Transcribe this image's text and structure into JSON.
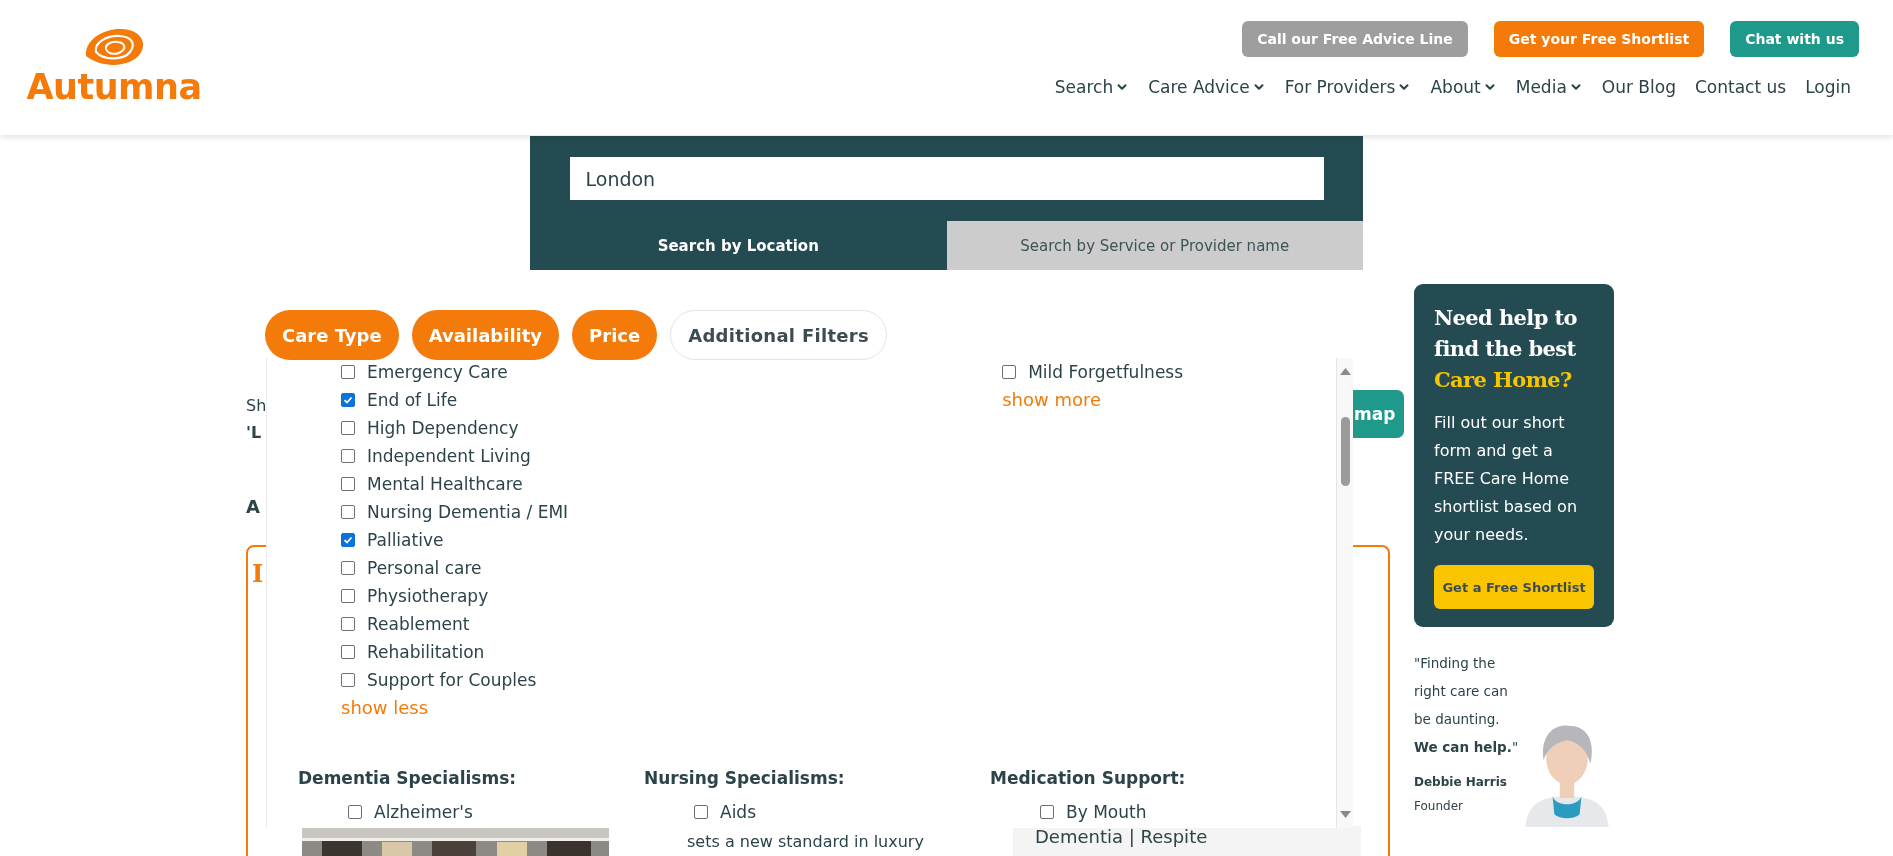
{
  "logo": {
    "text": "Autumna"
  },
  "top_buttons": [
    {
      "label": "Call our Free Advice Line",
      "kind": "gray"
    },
    {
      "label": "Get your Free Shortlist",
      "kind": "orange"
    },
    {
      "label": "Chat with us",
      "kind": "teal"
    }
  ],
  "nav": [
    {
      "label": "Search",
      "dropdown": true
    },
    {
      "label": "Care Advice",
      "dropdown": true
    },
    {
      "label": "For Providers",
      "dropdown": true
    },
    {
      "label": "About",
      "dropdown": true
    },
    {
      "label": "Media",
      "dropdown": true
    },
    {
      "label": "Our Blog",
      "dropdown": false
    },
    {
      "label": "Contact us",
      "dropdown": false
    },
    {
      "label": "Login",
      "dropdown": false
    }
  ],
  "search": {
    "value": "London",
    "tabs": [
      {
        "label": "Search by Location",
        "selected": true
      },
      {
        "label": "Search by Service or Provider name",
        "selected": false
      }
    ]
  },
  "filters": [
    {
      "label": "Care Type",
      "active": true
    },
    {
      "label": "Availability",
      "active": true
    },
    {
      "label": "Price",
      "active": true
    },
    {
      "label": "Additional Filters",
      "active": false
    }
  ],
  "dropdown": {
    "care_types": [
      {
        "label": "Emergency Care",
        "checked": false
      },
      {
        "label": "End of Life",
        "checked": true
      },
      {
        "label": "High Dependency",
        "checked": false
      },
      {
        "label": "Independent Living",
        "checked": false
      },
      {
        "label": "Mental Healthcare",
        "checked": false
      },
      {
        "label": "Nursing Dementia / EMI",
        "checked": false
      },
      {
        "label": "Palliative",
        "checked": true
      },
      {
        "label": "Personal care",
        "checked": false
      },
      {
        "label": "Physiotherapy",
        "checked": false
      },
      {
        "label": "Reablement",
        "checked": false
      },
      {
        "label": "Rehabilitation",
        "checked": false
      },
      {
        "label": "Support for Couples",
        "checked": false
      }
    ],
    "care_types_link": "show less",
    "column_3": [
      {
        "label": "Mild Forgetfulness",
        "checked": false
      }
    ],
    "column_3_link": "show more",
    "sections": [
      {
        "title": "Dementia Specialisms:",
        "options": [
          {
            "label": "Alzheimer's",
            "checked": false
          }
        ]
      },
      {
        "title": "Nursing Specialisms:",
        "options": [
          {
            "label": "Aids",
            "checked": false
          }
        ]
      },
      {
        "title": "Medication Support:",
        "options": [
          {
            "label": "By Mouth",
            "checked": false
          }
        ]
      }
    ]
  },
  "results": {
    "text_1": "Sh",
    "text_2": "'L",
    "heading": "A",
    "map_button": "map",
    "card_title": "I",
    "card_text": "sets a new standard in luxury",
    "card_tags": "Dementia | Respite"
  },
  "sidebar": {
    "title": "Need help to find the best",
    "highlight": "Care Home?",
    "body": "Fill out our short form and get a FREE Care Home shortlist based on your needs.",
    "button": "Get a Free Shortlist",
    "quote": "\"Finding the right care can be daunting. **We can help.**\"",
    "name": "Debbie Harris",
    "role": "Founder"
  }
}
